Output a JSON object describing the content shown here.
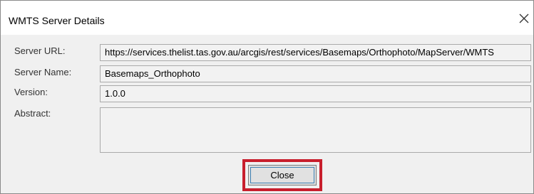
{
  "window": {
    "title": "WMTS Server Details",
    "close_icon": "close-x-icon"
  },
  "fields": {
    "server_url": {
      "label": "Server URL:",
      "value": "https://services.thelist.tas.gov.au/arcgis/rest/services/Basemaps/Orthophoto/MapServer/WMTS"
    },
    "server_name": {
      "label": "Server Name:",
      "value": "Basemaps_Orthophoto"
    },
    "version": {
      "label": "Version:",
      "value": "1.0.0"
    },
    "abstract": {
      "label": "Abstract:",
      "value": ""
    }
  },
  "buttons": {
    "close_label": "Close"
  },
  "colors": {
    "highlight": "#c81e2c",
    "focus_ring": "#3c7fb1"
  }
}
